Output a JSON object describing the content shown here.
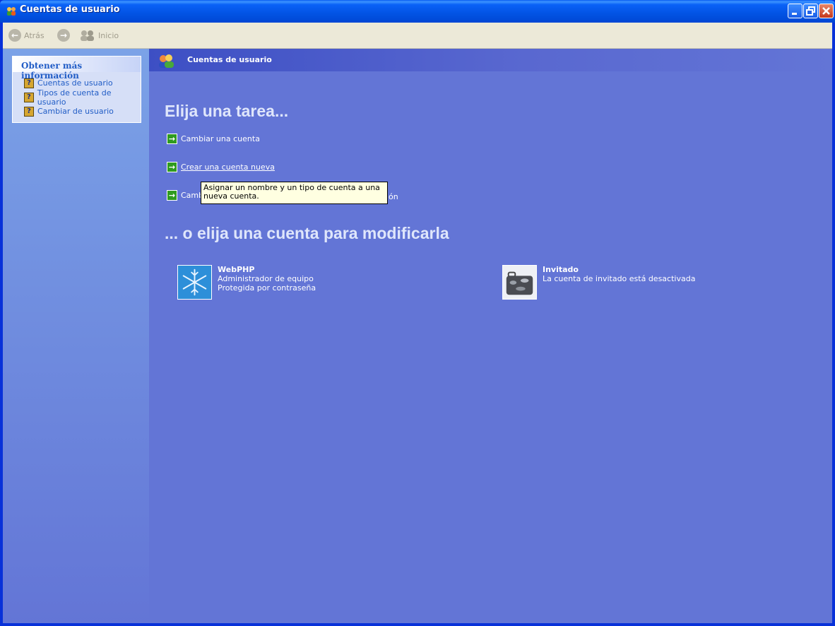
{
  "window": {
    "title": "Cuentas de usuario"
  },
  "toolbar": {
    "back_label": "Atrás",
    "home_label": "Inicio"
  },
  "sidebar": {
    "heading": "Obtener más información",
    "links": [
      {
        "label": "Cuentas de usuario",
        "icon": "help-icon"
      },
      {
        "label": "Tipos de cuenta de usuario",
        "icon": "help-icon"
      },
      {
        "label": "Cambiar de usuario",
        "icon": "help-icon"
      }
    ]
  },
  "main": {
    "header": "Cuentas de usuario",
    "task_heading": "Elija una tarea...",
    "tasks": [
      {
        "label": "Cambiar una cuenta"
      },
      {
        "label": "Crear una cuenta nueva"
      },
      {
        "label_start": "Camb",
        "label_end": "ón"
      }
    ],
    "tooltip": "Asignar un nombre y un tipo de cuenta a una nueva cuenta.",
    "accounts_heading": "... o elija una cuenta para modificarla",
    "accounts": [
      {
        "name": "WebPHP",
        "lines": [
          "Administrador de equipo",
          "Protegida por contraseña"
        ],
        "picture": "snowflake"
      },
      {
        "name": "Invitado",
        "lines": [
          "La cuenta de invitado está desactivada"
        ],
        "picture": "suitcase"
      }
    ]
  },
  "colors": {
    "main_bg": "#6375d6",
    "title_bar": "#0a62f7",
    "task_arrow": "#2f9b1f",
    "tooltip_bg": "#ffffe1"
  }
}
